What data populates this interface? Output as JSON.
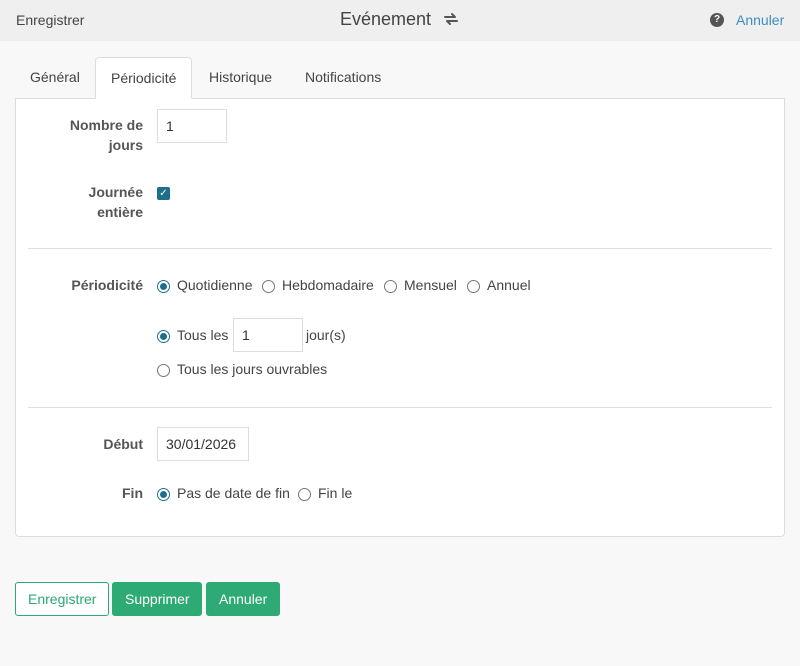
{
  "topbar": {
    "save_label": "Enregistrer",
    "title": "Evénement",
    "help": "?",
    "cancel_label": "Annuler"
  },
  "tabs": [
    {
      "label": "Général",
      "active": false
    },
    {
      "label": "Périodicité",
      "active": true
    },
    {
      "label": "Historique",
      "active": false
    },
    {
      "label": "Notifications",
      "active": false
    }
  ],
  "form": {
    "days_label": "Nombre de jours",
    "days_value": "1",
    "allday_label": "Journée entière",
    "allday_checked": true,
    "period_label": "Périodicité",
    "period_options": [
      "Quotidienne",
      "Hebdomadaire",
      "Mensuel",
      "Annuel"
    ],
    "period_selected": "Quotidienne",
    "every_prefix": "Tous les",
    "every_value": "1",
    "every_suffix": "jour(s)",
    "workdays_label": "Tous les jours ouvrables",
    "start_label": "Début",
    "start_value": "30/01/2026",
    "end_label": "Fin",
    "end_options": [
      "Pas de date de fin",
      "Fin le"
    ],
    "end_selected": "Pas de date de fin"
  },
  "footer": {
    "save_label": "Enregistrer",
    "delete_label": "Supprimer",
    "cancel_label": "Annuler"
  },
  "colors": {
    "accent_green": "#2eaa74",
    "link_blue": "#3d8ebf",
    "control_teal": "#1f6f8b"
  }
}
